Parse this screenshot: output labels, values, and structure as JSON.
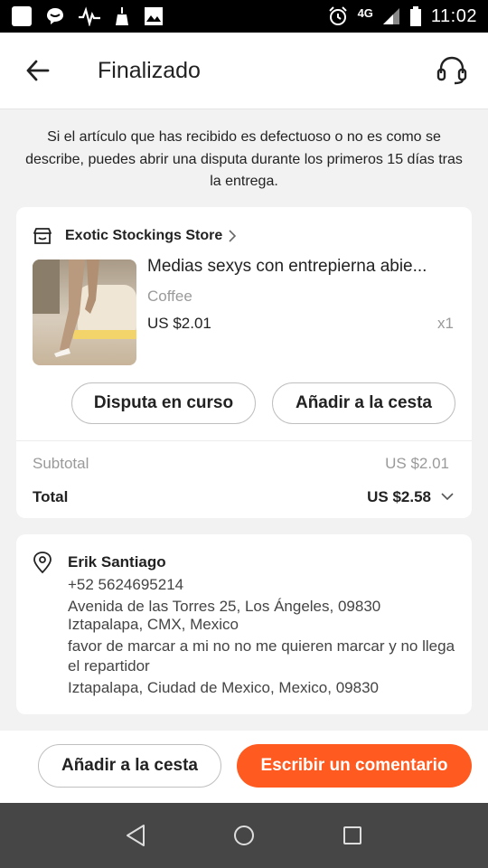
{
  "status_bar": {
    "network": "4G",
    "time": "11:02"
  },
  "header": {
    "title": "Finalizado"
  },
  "info_text": "Si el artículo que has recibido es defectuoso o no es como se describe, puedes abrir una disputa durante los primeros 15 días tras la entrega.",
  "order": {
    "store_name": "Exotic Stockings Store",
    "product": {
      "title": "Medias sexys con entrepierna abie...",
      "variant": "Coffee",
      "price": "US $2.01",
      "quantity": "x1"
    },
    "dispute_label": "Disputa en curso",
    "add_to_cart_label": "Añadir a la cesta",
    "subtotal_label": "Subtotal",
    "subtotal_value": "US $2.01",
    "total_label": "Total",
    "total_value": "US $2.58"
  },
  "address": {
    "name": "Erik Santiago",
    "phone": "+52 5624695214",
    "line1": "Avenida de las Torres 25, Los Ángeles, 09830",
    "line2": "Iztapalapa, CMX, Mexico",
    "note": "favor de marcar a mi no no me quieren marcar y no llega el repartidor",
    "line3": "Iztapalapa, Ciudad de Mexico, Mexico, 09830"
  },
  "bottom_bar": {
    "add_to_cart_label": "Añadir a la cesta",
    "review_label": "Escribir un comentario"
  },
  "colors": {
    "accent": "#ff5a1f",
    "navbar": "#464646"
  }
}
